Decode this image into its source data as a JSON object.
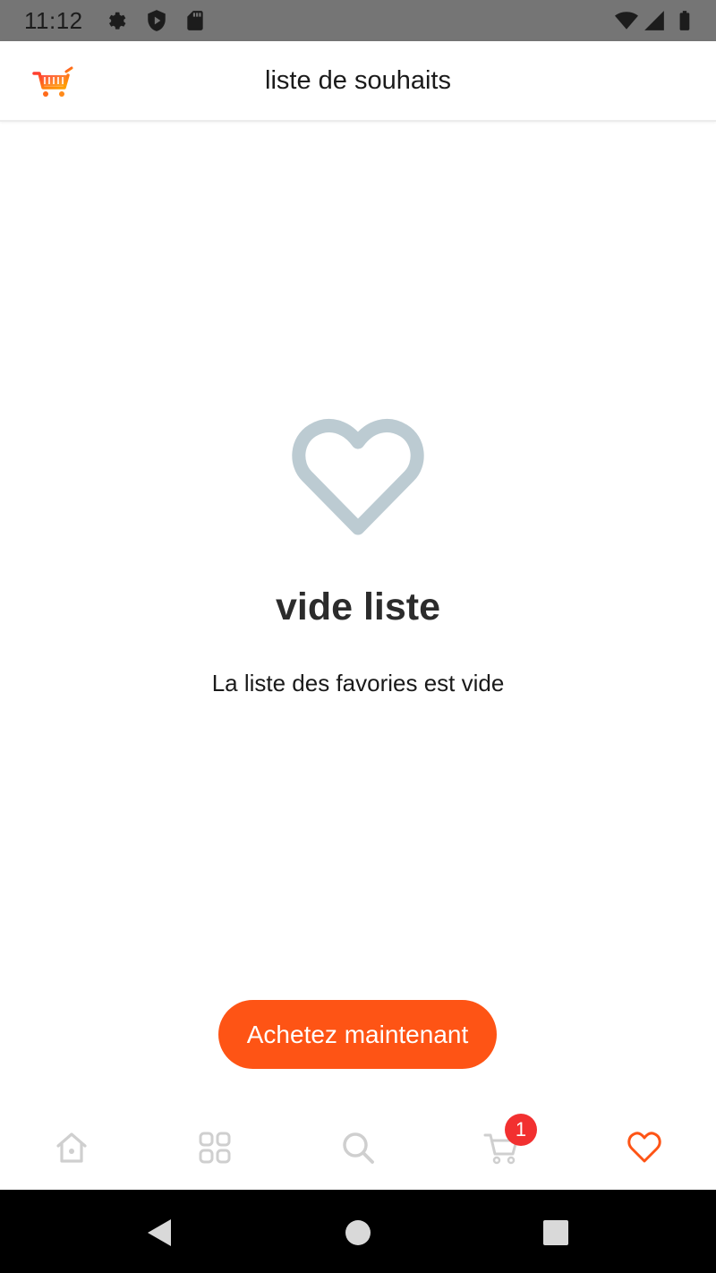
{
  "status_bar": {
    "time": "11:12",
    "icons": [
      "settings-icon",
      "shield-icon",
      "sd-card-icon",
      "wifi-icon",
      "signal-icon",
      "battery-icon"
    ],
    "background": "#757575"
  },
  "app_bar": {
    "title": "liste de souhaits",
    "logo_icon": "shopping-cart-logo-icon"
  },
  "empty_state": {
    "icon": "heart-outline-icon",
    "icon_color": "#bccbd2",
    "title": "vide liste",
    "subtitle": "La liste des favories est vide"
  },
  "cta": {
    "label": "Achetez maintenant",
    "color": "#fe5415"
  },
  "bottom_nav": {
    "items": [
      {
        "name": "home",
        "icon": "home-icon",
        "active": false
      },
      {
        "name": "categories",
        "icon": "grid-icon",
        "active": false
      },
      {
        "name": "search",
        "icon": "search-icon",
        "active": false
      },
      {
        "name": "cart",
        "icon": "cart-icon",
        "active": false,
        "badge": "1"
      },
      {
        "name": "wishlist",
        "icon": "heart-icon",
        "active": true
      }
    ],
    "active_color": "#fe5415",
    "inactive_color": "#cfcfcf",
    "badge_color": "#f23030"
  },
  "system_nav": {
    "buttons": [
      "back-icon",
      "home-circle-icon",
      "recents-icon"
    ]
  }
}
